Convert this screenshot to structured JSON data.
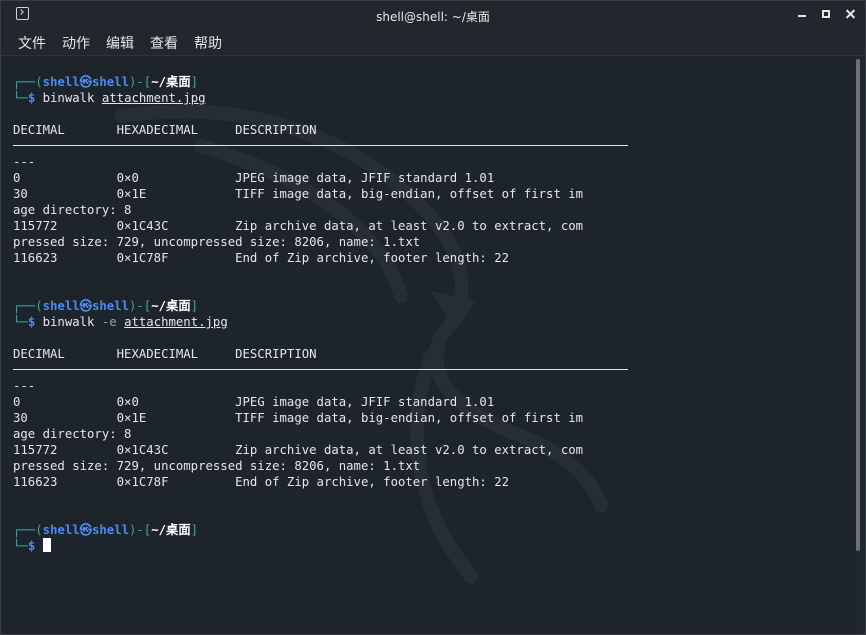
{
  "window": {
    "title": "shell@shell: ~/桌面"
  },
  "menu": {
    "items": [
      "文件",
      "动作",
      "编辑",
      "查看",
      "帮助"
    ]
  },
  "prompt": {
    "open": "┌──(",
    "user": "shell",
    "at": "㉿",
    "host": "shell",
    "mid": ")-[",
    "path": "~/桌面",
    "close": "]",
    "line2": "└─",
    "dollar": "$"
  },
  "blocks": [
    {
      "cmd": "binwalk",
      "flag": "",
      "file": "attachment.jpg",
      "header": "DECIMAL       HEXADECIMAL     DESCRIPTION",
      "dashes": "---",
      "rows": [
        "0             0×0             JPEG image data, JFIF standard 1.01",
        "30            0×1E            TIFF image data, big-endian, offset of first im",
        "age directory: 8",
        "115772        0×1C43C         Zip archive data, at least v2.0 to extract, com",
        "pressed size: 729, uncompressed size: 8206, name: 1.txt",
        "116623        0×1C78F         End of Zip archive, footer length: 22"
      ]
    },
    {
      "cmd": "binwalk",
      "flag": "-e",
      "file": "attachment.jpg",
      "header": "DECIMAL       HEXADECIMAL     DESCRIPTION",
      "dashes": "---",
      "rows": [
        "0             0×0             JPEG image data, JFIF standard 1.01",
        "30            0×1E            TIFF image data, big-endian, offset of first im",
        "age directory: 8",
        "115772        0×1C43C         Zip archive data, at least v2.0 to extract, com",
        "pressed size: 729, uncompressed size: 8206, name: 1.txt",
        "116623        0×1C78F         End of Zip archive, footer length: 22"
      ]
    }
  ]
}
